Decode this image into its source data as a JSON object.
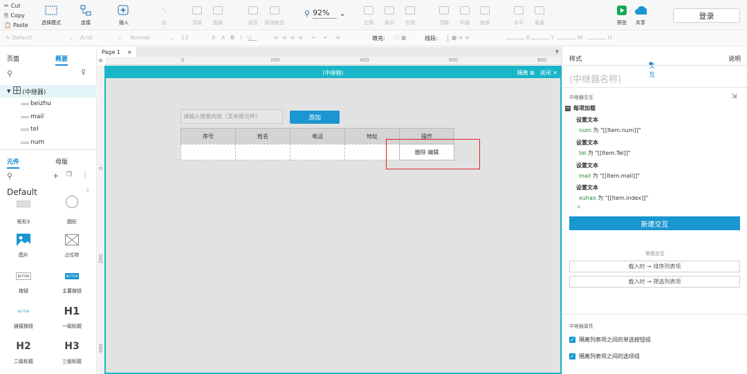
{
  "clipboard": {
    "cut": "Cut",
    "copy": "Copy",
    "paste": "Paste"
  },
  "toolbar": {
    "select_mode": "选择模式",
    "connect": "连接",
    "insert": "插入",
    "point": "点",
    "front": "顶层",
    "back": "底层",
    "group": "组合",
    "ungroup": "取消组合",
    "zoom": "92%",
    "left": "左侧",
    "center": "居中",
    "right": "右侧",
    "top": "顶部",
    "middle": "中部",
    "bottom": "底部",
    "horizontal": "水平",
    "vertical": "垂直",
    "preview": "预览",
    "share": "共享",
    "login": "登录"
  },
  "formatbar": {
    "style": "Default",
    "font": "Arial",
    "weight": "Normal",
    "size": "13",
    "fill_label": "填充:",
    "line_label": "线段:",
    "line_value": "1",
    "x_label": "X",
    "y_label": "Y",
    "w_label": "W",
    "h_label": "H"
  },
  "left": {
    "tab_pages": "页面",
    "tab_outline": "概要",
    "tree": [
      "(中继器)",
      "beizhu",
      "mail",
      "tel",
      "num"
    ],
    "tab_widgets": "元件",
    "tab_masters": "母版",
    "library": "Default",
    "widgets": [
      {
        "label": "矩形3",
        "icon": "rectangle-icon"
      },
      {
        "label": "圆形",
        "icon": "circle-icon"
      },
      {
        "label": "图片",
        "icon": "image-icon"
      },
      {
        "label": "占位符",
        "icon": "placeholder-icon"
      },
      {
        "label": "按钮",
        "icon": "button-icon",
        "text": "BUTTON"
      },
      {
        "label": "主要按钮",
        "icon": "primary-button-icon",
        "text": "BUTTON"
      },
      {
        "label": "链接按钮",
        "icon": "link-button-icon",
        "text": "BUTTON"
      },
      {
        "label": "一级标题",
        "icon": "h1-icon",
        "text": "H1"
      },
      {
        "label": "二级标题",
        "icon": "h2-icon",
        "text": "H2"
      },
      {
        "label": "三级标题",
        "icon": "h3-icon",
        "text": "H3"
      }
    ]
  },
  "canvas": {
    "page_tab": "Page 1",
    "ruler_h": [
      "0",
      "200",
      "400",
      "600",
      "800"
    ],
    "ruler_v": [
      "0",
      "200",
      "400"
    ],
    "repeater_title": "(中继器)",
    "isolate": "隔离",
    "close": "关闭",
    "search_placeholder": "请输入搜索内容（文本框元件）",
    "add_button": "添加",
    "headers": [
      "序号",
      "姓名",
      "电话",
      "地址",
      "操作"
    ],
    "row_actions": "删除  编辑"
  },
  "right": {
    "tab_style": "样式",
    "tab_interaction": "交互",
    "tab_notes": "说明",
    "repeater_name_placeholder": "(中继器名称)",
    "section_interaction": "中继器交互",
    "event": "每项加载",
    "actions": [
      {
        "title": "设置文本",
        "target": "num",
        "expr": "为 \"[[Item.num]]\""
      },
      {
        "title": "设置文本",
        "target": "tel",
        "expr": "为 \"[[Item.Tel]]\""
      },
      {
        "title": "设置文本",
        "target": "mail",
        "expr": "为 \"[[Item.mail]]\""
      },
      {
        "title": "设置文本",
        "target": "xuhao",
        "expr": "为 \"[[Item.index]]\""
      }
    ],
    "new_interaction": "新建交互",
    "common_interactions": "常用交互",
    "sort_items": "载入时 → 排序列表项",
    "filter_items": "载入时 → 筛选列表项",
    "section_props": "中继器属性",
    "opt_radio": "隔离列表项之间的单选按钮组",
    "opt_group": "隔离列表项之间的选项组"
  },
  "colors": {
    "accent": "#1a96d1",
    "repeater": "#18b6c8",
    "highlight": "#e02020"
  }
}
